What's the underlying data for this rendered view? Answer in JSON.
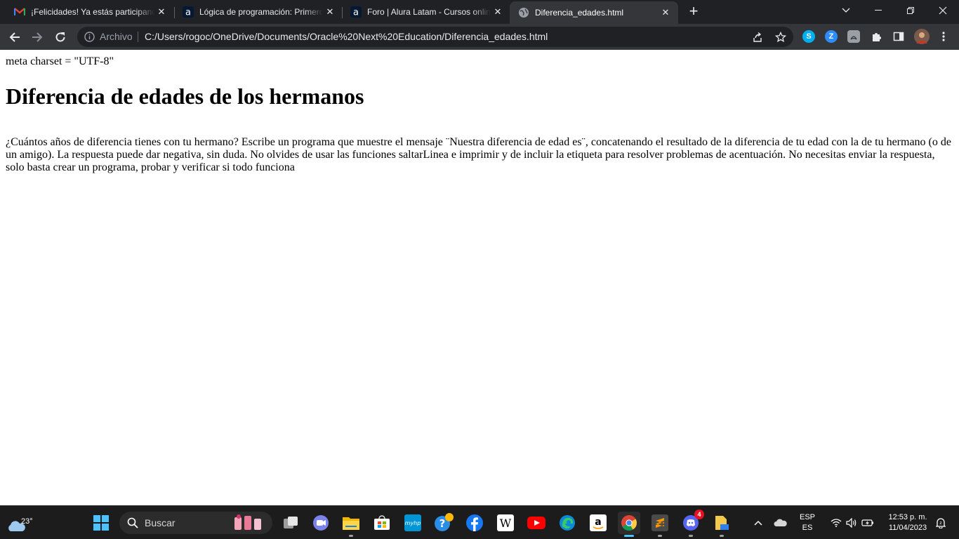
{
  "browser": {
    "tabs": [
      {
        "title": "¡Felicidades! Ya estás participando",
        "icon": "gmail-icon",
        "active": false
      },
      {
        "title": "Lógica de programación: Primeros pasos",
        "icon": "alura-icon",
        "active": false
      },
      {
        "title": "Foro | Alura Latam - Cursos online",
        "icon": "alura-icon",
        "active": false
      },
      {
        "title": "Diferencia_edades.html",
        "icon": "globe-icon",
        "active": true
      }
    ],
    "new_tab_label": "+",
    "close_glyph": "✕",
    "omnibox": {
      "chip": "Archivo",
      "url": "C:/Users/rogoc/OneDrive/Documents/Oracle%20Next%20Education/Diferencia_edades.html"
    },
    "extensions": [
      {
        "name": "skype",
        "letter": "S",
        "color": "#00aff0"
      },
      {
        "name": "zoom",
        "letter": "Z",
        "color": "#2d8cff"
      },
      {
        "name": "acrobat",
        "letter": "",
        "color": "#9aa0a6"
      }
    ]
  },
  "page": {
    "meta_text": "meta charset = \"UTF-8\"",
    "heading": "Diferencia de edades de los hermanos",
    "paragraph": "¿Cuántos años de diferencia tienes con tu hermano? Escribe un programa que muestre el mensaje ¨Nuestra diferencia de edad es¨, concatenando el resultado de la diferencia de tu edad con la de tu hermano (o de un amigo). La respuesta puede dar negativa, sin duda. No olvides de usar las funciones saltarLinea e imprimir y de incluir la etiqueta para resolver problemas de acentuación. No necesitas enviar la respuesta, solo basta crear un programa, probar y verificar si todo funciona"
  },
  "taskbar": {
    "weather_temp": "23°",
    "search_label": "Buscar",
    "discord_badge": "4",
    "lang_top": "ESP",
    "lang_bottom": "ES",
    "time": "12:53 p. m.",
    "date": "11/04/2023"
  },
  "colors": {
    "tabstrip_bg": "#202124",
    "toolbar_bg": "#35363a",
    "taskbar_bg": "#1c1c1c",
    "accent": "#4cc2ff"
  }
}
